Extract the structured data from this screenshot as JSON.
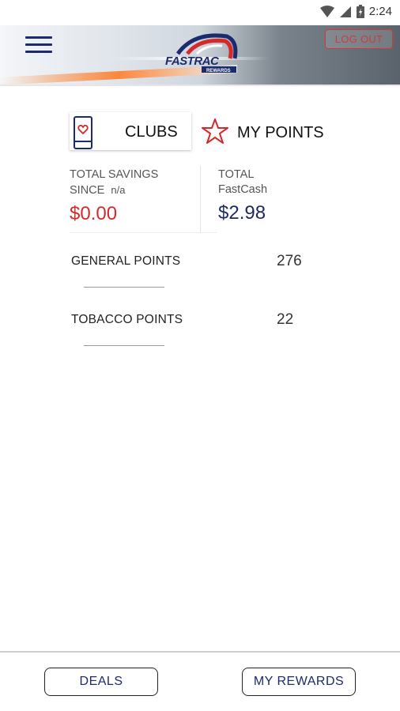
{
  "status_bar": {
    "time": "2:24"
  },
  "header": {
    "logout_label": "LOG OUT",
    "logo_text": "FASTRAC",
    "logo_subtext": "REWARDS"
  },
  "tabs": {
    "clubs_label": "CLUBS",
    "points_label": "MY POINTS"
  },
  "summary": {
    "savings_label_line1": "TOTAL SAVINGS",
    "savings_label_line2": "SINCE",
    "savings_since_value": "n/a",
    "savings_amount": "$0.00",
    "fastcash_label_line1": "TOTAL",
    "fastcash_label_line2": "FastCash",
    "fastcash_amount": "$2.98"
  },
  "points": [
    {
      "name": "GENERAL POINTS",
      "value": "276"
    },
    {
      "name": "TOBACCO POINTS",
      "value": "22"
    }
  ],
  "bottom_nav": {
    "deals_label": "DEALS",
    "rewards_label": "MY REWARDS"
  },
  "colors": {
    "accent_red": "#d42a2a",
    "navy": "#1c2a6e"
  }
}
